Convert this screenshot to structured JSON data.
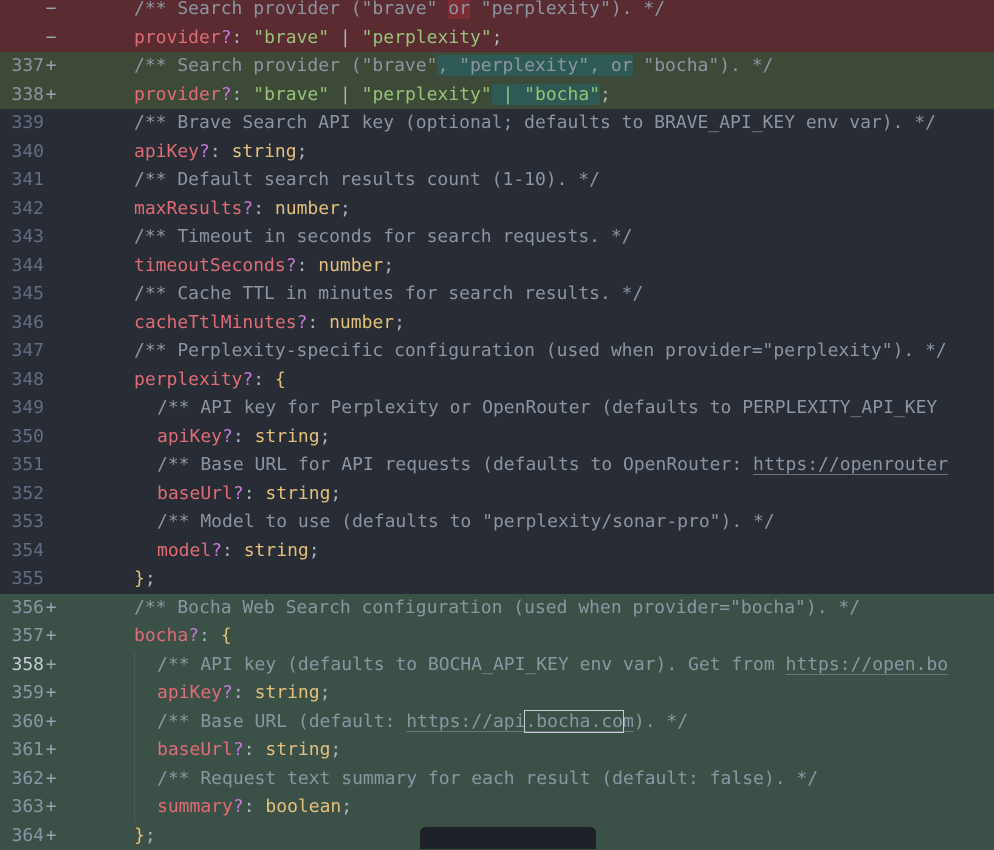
{
  "editor": {
    "lines": [
      {
        "num": "",
        "marker": "−",
        "kind": "removed",
        "indent": 0,
        "segs": [
          [
            "c",
            "/** Search provider (\"brave\" "
          ],
          [
            "c hl-red",
            "or"
          ],
          [
            "c",
            " \"perplexity\"). */"
          ]
        ]
      },
      {
        "num": "",
        "marker": "−",
        "kind": "removed",
        "indent": 0,
        "segs": [
          [
            "p",
            "provider"
          ],
          [
            "op",
            "?"
          ],
          [
            "pl",
            ": "
          ],
          [
            "s",
            "\"brave\""
          ],
          [
            "pl",
            " | "
          ],
          [
            "s",
            "\"perplexity\""
          ],
          [
            "pl",
            ";"
          ]
        ]
      },
      {
        "num": "337",
        "marker": "+",
        "kind": "added-mod",
        "indent": 0,
        "segs": [
          [
            "c",
            "/** Search provider (\"brave\""
          ],
          [
            "c hl-green",
            ", \"perplexity\", or"
          ],
          [
            "c",
            " \"bocha\"). */"
          ]
        ]
      },
      {
        "num": "338",
        "marker": "+",
        "kind": "added-mod",
        "indent": 0,
        "segs": [
          [
            "p",
            "provider"
          ],
          [
            "op",
            "?"
          ],
          [
            "pl",
            ": "
          ],
          [
            "s",
            "\"brave\""
          ],
          [
            "pl",
            " | "
          ],
          [
            "s",
            "\"perplexity\""
          ],
          [
            "s hl-green",
            " | \"bocha\""
          ],
          [
            "pl",
            ";"
          ]
        ]
      },
      {
        "num": "339",
        "marker": "",
        "kind": "",
        "indent": 0,
        "segs": [
          [
            "c",
            "/** Brave Search API key (optional; defaults to BRAVE_API_KEY env var). */"
          ]
        ]
      },
      {
        "num": "340",
        "marker": "",
        "kind": "",
        "indent": 0,
        "segs": [
          [
            "p",
            "apiKey"
          ],
          [
            "op",
            "?"
          ],
          [
            "pl",
            ": "
          ],
          [
            "t",
            "string"
          ],
          [
            "pl",
            ";"
          ]
        ]
      },
      {
        "num": "341",
        "marker": "",
        "kind": "",
        "indent": 0,
        "segs": [
          [
            "c",
            "/** Default search results count (1-10). */"
          ]
        ]
      },
      {
        "num": "342",
        "marker": "",
        "kind": "",
        "indent": 0,
        "segs": [
          [
            "p",
            "maxResults"
          ],
          [
            "op",
            "?"
          ],
          [
            "pl",
            ": "
          ],
          [
            "t",
            "number"
          ],
          [
            "pl",
            ";"
          ]
        ]
      },
      {
        "num": "343",
        "marker": "",
        "kind": "",
        "indent": 0,
        "segs": [
          [
            "c",
            "/** Timeout in seconds for search requests. */"
          ]
        ]
      },
      {
        "num": "344",
        "marker": "",
        "kind": "",
        "indent": 0,
        "segs": [
          [
            "p",
            "timeoutSeconds"
          ],
          [
            "op",
            "?"
          ],
          [
            "pl",
            ": "
          ],
          [
            "t",
            "number"
          ],
          [
            "pl",
            ";"
          ]
        ]
      },
      {
        "num": "345",
        "marker": "",
        "kind": "",
        "indent": 0,
        "segs": [
          [
            "c",
            "/** Cache TTL in minutes for search results. */"
          ]
        ]
      },
      {
        "num": "346",
        "marker": "",
        "kind": "",
        "indent": 0,
        "segs": [
          [
            "p",
            "cacheTtlMinutes"
          ],
          [
            "op",
            "?"
          ],
          [
            "pl",
            ": "
          ],
          [
            "t",
            "number"
          ],
          [
            "pl",
            ";"
          ]
        ]
      },
      {
        "num": "347",
        "marker": "",
        "kind": "",
        "indent": 0,
        "segs": [
          [
            "c",
            "/** Perplexity-specific configuration (used when provider=\"perplexity\"). */"
          ]
        ]
      },
      {
        "num": "348",
        "marker": "",
        "kind": "",
        "indent": 0,
        "segs": [
          [
            "p",
            "perplexity"
          ],
          [
            "op",
            "?"
          ],
          [
            "pl",
            ": "
          ],
          [
            "br",
            "{"
          ]
        ]
      },
      {
        "num": "349",
        "marker": "",
        "kind": "",
        "indent": 1,
        "segs": [
          [
            "c",
            "/** API key for Perplexity or OpenRouter (defaults to PERPLEXITY_API_KEY"
          ]
        ]
      },
      {
        "num": "350",
        "marker": "",
        "kind": "",
        "indent": 1,
        "segs": [
          [
            "p",
            "apiKey"
          ],
          [
            "op",
            "?"
          ],
          [
            "pl",
            ": "
          ],
          [
            "t",
            "string"
          ],
          [
            "pl",
            ";"
          ]
        ]
      },
      {
        "num": "351",
        "marker": "",
        "kind": "",
        "indent": 1,
        "segs": [
          [
            "c",
            "/** Base URL for API requests (defaults to OpenRouter: "
          ],
          [
            "link",
            "https://openrouter"
          ]
        ]
      },
      {
        "num": "352",
        "marker": "",
        "kind": "",
        "indent": 1,
        "segs": [
          [
            "p",
            "baseUrl"
          ],
          [
            "op",
            "?"
          ],
          [
            "pl",
            ": "
          ],
          [
            "t",
            "string"
          ],
          [
            "pl",
            ";"
          ]
        ]
      },
      {
        "num": "353",
        "marker": "",
        "kind": "",
        "indent": 1,
        "segs": [
          [
            "c",
            "/** Model to use (defaults to \"perplexity/sonar-pro\"). */"
          ]
        ]
      },
      {
        "num": "354",
        "marker": "",
        "kind": "",
        "indent": 1,
        "segs": [
          [
            "p",
            "model"
          ],
          [
            "op",
            "?"
          ],
          [
            "pl",
            ": "
          ],
          [
            "t",
            "string"
          ],
          [
            "pl",
            ";"
          ]
        ]
      },
      {
        "num": "355",
        "marker": "",
        "kind": "",
        "indent": 0,
        "segs": [
          [
            "br",
            "}"
          ],
          [
            "pl",
            ";"
          ]
        ]
      },
      {
        "num": "356",
        "marker": "+",
        "kind": "added",
        "indent": 0,
        "segs": [
          [
            "c",
            "/** Bocha Web Search configuration (used when provider=\"bocha\"). */"
          ]
        ]
      },
      {
        "num": "357",
        "marker": "+",
        "kind": "added",
        "indent": 0,
        "segs": [
          [
            "p",
            "bocha"
          ],
          [
            "op",
            "?"
          ],
          [
            "pl",
            ": "
          ],
          [
            "br",
            "{"
          ]
        ]
      },
      {
        "num": "358",
        "marker": "+",
        "kind": "added cur",
        "indent": 1,
        "guide": true,
        "segs": [
          [
            "c",
            "/** API key (defaults to BOCHA_API_KEY env var). Get from "
          ],
          [
            "link",
            "https://open.bo"
          ]
        ]
      },
      {
        "num": "359",
        "marker": "+",
        "kind": "added",
        "indent": 1,
        "guide": true,
        "segs": [
          [
            "p",
            "apiKey"
          ],
          [
            "op",
            "?"
          ],
          [
            "pl",
            ": "
          ],
          [
            "t",
            "string"
          ],
          [
            "pl",
            ";"
          ]
        ]
      },
      {
        "num": "360",
        "marker": "+",
        "kind": "added",
        "indent": 1,
        "guide": true,
        "segs": [
          [
            "c",
            "/** Base URL (default: "
          ],
          [
            "link",
            "https://api"
          ],
          [
            "link sel-box",
            ".bocha.co"
          ],
          [
            "link",
            "m"
          ],
          [
            "c",
            "). */"
          ]
        ]
      },
      {
        "num": "361",
        "marker": "+",
        "kind": "added",
        "indent": 1,
        "guide": true,
        "segs": [
          [
            "p",
            "baseUrl"
          ],
          [
            "op",
            "?"
          ],
          [
            "pl",
            ": "
          ],
          [
            "t",
            "string"
          ],
          [
            "pl",
            ";"
          ]
        ]
      },
      {
        "num": "362",
        "marker": "+",
        "kind": "added",
        "indent": 1,
        "guide": true,
        "segs": [
          [
            "c",
            "/** Request text summary for each result (default: false). */"
          ]
        ]
      },
      {
        "num": "363",
        "marker": "+",
        "kind": "added",
        "indent": 1,
        "guide": true,
        "segs": [
          [
            "p",
            "summary"
          ],
          [
            "op",
            "?"
          ],
          [
            "pl",
            ": "
          ],
          [
            "t",
            "boolean"
          ],
          [
            "pl",
            ";"
          ]
        ]
      },
      {
        "num": "364",
        "marker": "+",
        "kind": "added",
        "indent": 0,
        "segs": [
          [
            "br",
            "}"
          ],
          [
            "pl",
            ";"
          ]
        ]
      }
    ]
  }
}
